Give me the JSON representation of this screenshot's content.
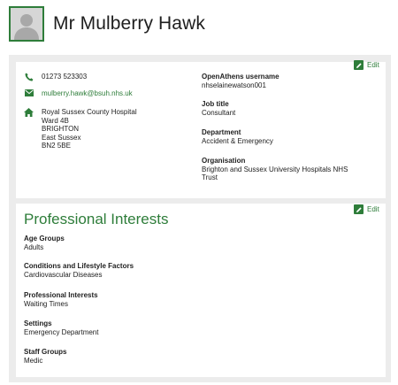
{
  "profile": {
    "name": "Mr Mulberry Hawk",
    "avatar_icon": "person-silhouette-icon"
  },
  "contact": {
    "phone": "01273 523303",
    "email": "mulberry.hawk@bsuh.nhs.uk",
    "address": [
      "Royal Sussex County Hospital",
      "Ward 4B",
      "BRIGHTON",
      "East Sussex",
      "BN2 5BE"
    ],
    "edit_label": "Edit"
  },
  "details": {
    "openathens_label": "OpenAthens username",
    "openathens_value": "nhselainewatson001",
    "job_label": "Job title",
    "job_value": "Consultant",
    "department_label": "Department",
    "department_value": "Accident & Emergency",
    "organisation_label": "Organisation",
    "organisation_value": [
      "Brighton and Sussex University Hospitals NHS",
      "Trust"
    ]
  },
  "interests": {
    "title": "Professional Interests",
    "edit_label": "Edit",
    "items": [
      {
        "label": "Age Groups",
        "value": "Adults"
      },
      {
        "label": "Conditions and Lifestyle Factors",
        "value": "Cardiovascular Diseases"
      },
      {
        "label": "Professional Interests",
        "value": "Waiting Times"
      },
      {
        "label": "Settings",
        "value": "Emergency Department"
      },
      {
        "label": "Staff Groups",
        "value": "Medic"
      }
    ]
  },
  "colors": {
    "brand_green": "#2e7d3a",
    "panel_bg": "#ececec"
  }
}
